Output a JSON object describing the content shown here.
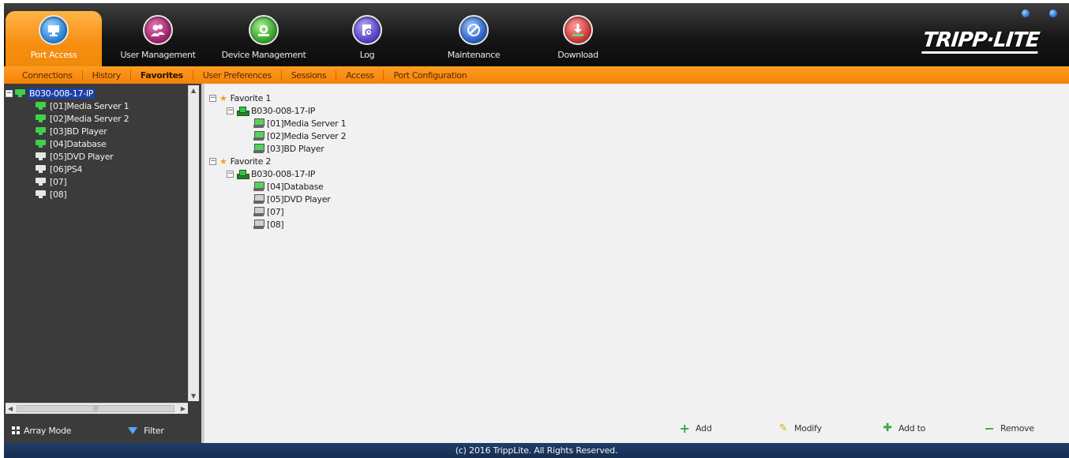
{
  "header": {
    "brand": "TRIPP·LITE",
    "tabs": [
      {
        "label": "Port Access",
        "icon": "port-access-icon",
        "active": true
      },
      {
        "label": "User Management",
        "icon": "user-management-icon"
      },
      {
        "label": "Device Management",
        "icon": "device-management-icon"
      },
      {
        "label": "Log",
        "icon": "log-icon"
      },
      {
        "label": "Maintenance",
        "icon": "maintenance-icon"
      },
      {
        "label": "Download",
        "icon": "download-icon"
      }
    ]
  },
  "subnav": {
    "items": [
      {
        "label": "Connections"
      },
      {
        "label": "History"
      },
      {
        "label": "Favorites",
        "active": true
      },
      {
        "label": "User Preferences"
      },
      {
        "label": "Sessions"
      },
      {
        "label": "Access"
      },
      {
        "label": "Port Configuration"
      }
    ]
  },
  "left_panel": {
    "root": "B030-008-17-IP",
    "ports": [
      {
        "label": "[01]Media Server 1",
        "status": "online"
      },
      {
        "label": "[02]Media Server 2",
        "status": "online"
      },
      {
        "label": "[03]BD Player",
        "status": "online"
      },
      {
        "label": "[04]Database",
        "status": "online"
      },
      {
        "label": "[05]DVD Player",
        "status": "offline"
      },
      {
        "label": "[06]PS4",
        "status": "offline"
      },
      {
        "label": "[07]",
        "status": "offline"
      },
      {
        "label": "[08]",
        "status": "offline"
      }
    ],
    "array_mode_label": "Array Mode",
    "filter_label": "Filter"
  },
  "favorites": [
    {
      "name": "Favorite 1",
      "device": "B030-008-17-IP",
      "ports": [
        {
          "label": "[01]Media Server 1",
          "status": "online"
        },
        {
          "label": "[02]Media Server 2",
          "status": "online"
        },
        {
          "label": "[03]BD Player",
          "status": "online"
        }
      ]
    },
    {
      "name": "Favorite 2",
      "device": "B030-008-17-IP",
      "ports": [
        {
          "label": "[04]Database",
          "status": "online"
        },
        {
          "label": "[05]DVD Player",
          "status": "offline"
        },
        {
          "label": "[07]",
          "status": "offline"
        },
        {
          "label": "[08]",
          "status": "offline"
        }
      ]
    }
  ],
  "actions": {
    "add": "Add",
    "modify": "Modify",
    "add_to": "Add to",
    "remove": "Remove"
  },
  "footer": {
    "copyright": "(c) 2016 TrippLite. All Rights Reserved."
  },
  "colors": {
    "accent_orange": "#f38207",
    "online_green": "#3ed14a",
    "statusbar_blue": "#1f3d68"
  }
}
